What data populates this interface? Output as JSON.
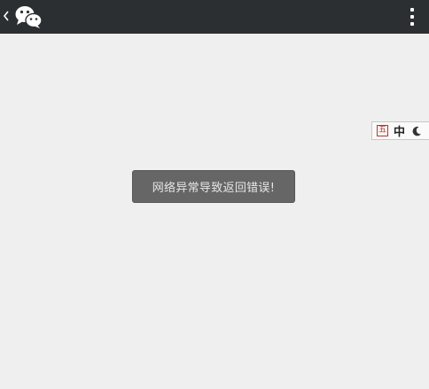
{
  "topbar": {
    "background": "#2b2f31",
    "back_icon": "chevron-left-icon",
    "logo_icon": "wechat-logo-icon",
    "menu_icon": "more-vertical-icon"
  },
  "ime": {
    "mode_icon": "wubi-input-icon",
    "mode_icon_text": "五",
    "language": "中",
    "theme_icon": "moon-icon"
  },
  "toast": {
    "message": "网络异常导致返回错误!"
  },
  "colors": {
    "page_background": "#efefef",
    "toast_background": "#666666",
    "toast_text": "#e6e6e6"
  }
}
